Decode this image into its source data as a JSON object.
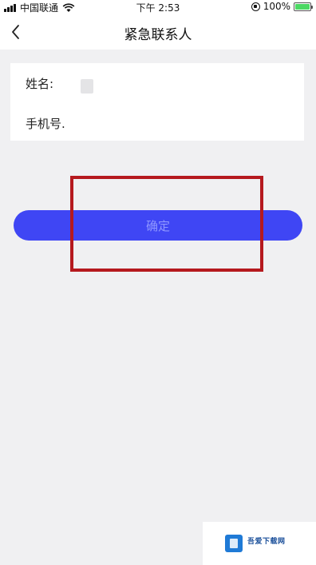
{
  "status_bar": {
    "carrier": "中国联通",
    "time": "下午 2:53",
    "battery_percent": "100%",
    "battery_color": "#4cd964"
  },
  "nav": {
    "title": "紧急联系人",
    "back_icon": "chevron-left-icon"
  },
  "form": {
    "name_label": "姓名:",
    "phone_label": "手机号."
  },
  "confirm_button": {
    "label": "确定",
    "color": "#3f46f4"
  },
  "highlight": {
    "color": "#b5191e"
  },
  "watermark": {
    "title": "吾爱下载网"
  }
}
